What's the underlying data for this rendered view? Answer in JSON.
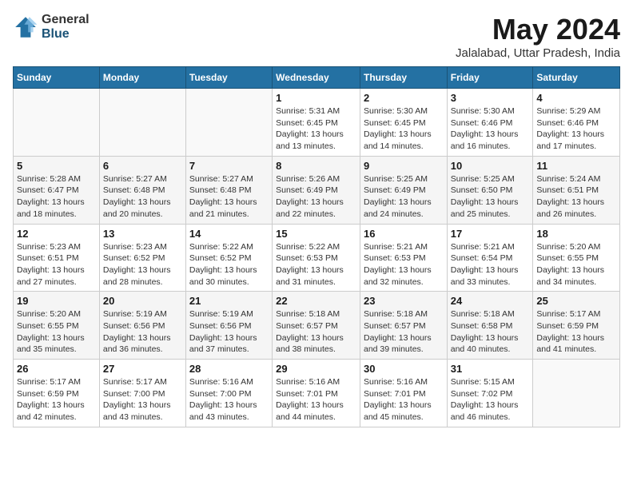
{
  "logo": {
    "general": "General",
    "blue": "Blue"
  },
  "title": "May 2024",
  "location": "Jalalabad, Uttar Pradesh, India",
  "days_of_week": [
    "Sunday",
    "Monday",
    "Tuesday",
    "Wednesday",
    "Thursday",
    "Friday",
    "Saturday"
  ],
  "weeks": [
    [
      {
        "day": "",
        "info": ""
      },
      {
        "day": "",
        "info": ""
      },
      {
        "day": "",
        "info": ""
      },
      {
        "day": "1",
        "info": "Sunrise: 5:31 AM\nSunset: 6:45 PM\nDaylight: 13 hours\nand 13 minutes."
      },
      {
        "day": "2",
        "info": "Sunrise: 5:30 AM\nSunset: 6:45 PM\nDaylight: 13 hours\nand 14 minutes."
      },
      {
        "day": "3",
        "info": "Sunrise: 5:30 AM\nSunset: 6:46 PM\nDaylight: 13 hours\nand 16 minutes."
      },
      {
        "day": "4",
        "info": "Sunrise: 5:29 AM\nSunset: 6:46 PM\nDaylight: 13 hours\nand 17 minutes."
      }
    ],
    [
      {
        "day": "5",
        "info": "Sunrise: 5:28 AM\nSunset: 6:47 PM\nDaylight: 13 hours\nand 18 minutes."
      },
      {
        "day": "6",
        "info": "Sunrise: 5:27 AM\nSunset: 6:48 PM\nDaylight: 13 hours\nand 20 minutes."
      },
      {
        "day": "7",
        "info": "Sunrise: 5:27 AM\nSunset: 6:48 PM\nDaylight: 13 hours\nand 21 minutes."
      },
      {
        "day": "8",
        "info": "Sunrise: 5:26 AM\nSunset: 6:49 PM\nDaylight: 13 hours\nand 22 minutes."
      },
      {
        "day": "9",
        "info": "Sunrise: 5:25 AM\nSunset: 6:49 PM\nDaylight: 13 hours\nand 24 minutes."
      },
      {
        "day": "10",
        "info": "Sunrise: 5:25 AM\nSunset: 6:50 PM\nDaylight: 13 hours\nand 25 minutes."
      },
      {
        "day": "11",
        "info": "Sunrise: 5:24 AM\nSunset: 6:51 PM\nDaylight: 13 hours\nand 26 minutes."
      }
    ],
    [
      {
        "day": "12",
        "info": "Sunrise: 5:23 AM\nSunset: 6:51 PM\nDaylight: 13 hours\nand 27 minutes."
      },
      {
        "day": "13",
        "info": "Sunrise: 5:23 AM\nSunset: 6:52 PM\nDaylight: 13 hours\nand 28 minutes."
      },
      {
        "day": "14",
        "info": "Sunrise: 5:22 AM\nSunset: 6:52 PM\nDaylight: 13 hours\nand 30 minutes."
      },
      {
        "day": "15",
        "info": "Sunrise: 5:22 AM\nSunset: 6:53 PM\nDaylight: 13 hours\nand 31 minutes."
      },
      {
        "day": "16",
        "info": "Sunrise: 5:21 AM\nSunset: 6:53 PM\nDaylight: 13 hours\nand 32 minutes."
      },
      {
        "day": "17",
        "info": "Sunrise: 5:21 AM\nSunset: 6:54 PM\nDaylight: 13 hours\nand 33 minutes."
      },
      {
        "day": "18",
        "info": "Sunrise: 5:20 AM\nSunset: 6:55 PM\nDaylight: 13 hours\nand 34 minutes."
      }
    ],
    [
      {
        "day": "19",
        "info": "Sunrise: 5:20 AM\nSunset: 6:55 PM\nDaylight: 13 hours\nand 35 minutes."
      },
      {
        "day": "20",
        "info": "Sunrise: 5:19 AM\nSunset: 6:56 PM\nDaylight: 13 hours\nand 36 minutes."
      },
      {
        "day": "21",
        "info": "Sunrise: 5:19 AM\nSunset: 6:56 PM\nDaylight: 13 hours\nand 37 minutes."
      },
      {
        "day": "22",
        "info": "Sunrise: 5:18 AM\nSunset: 6:57 PM\nDaylight: 13 hours\nand 38 minutes."
      },
      {
        "day": "23",
        "info": "Sunrise: 5:18 AM\nSunset: 6:57 PM\nDaylight: 13 hours\nand 39 minutes."
      },
      {
        "day": "24",
        "info": "Sunrise: 5:18 AM\nSunset: 6:58 PM\nDaylight: 13 hours\nand 40 minutes."
      },
      {
        "day": "25",
        "info": "Sunrise: 5:17 AM\nSunset: 6:59 PM\nDaylight: 13 hours\nand 41 minutes."
      }
    ],
    [
      {
        "day": "26",
        "info": "Sunrise: 5:17 AM\nSunset: 6:59 PM\nDaylight: 13 hours\nand 42 minutes."
      },
      {
        "day": "27",
        "info": "Sunrise: 5:17 AM\nSunset: 7:00 PM\nDaylight: 13 hours\nand 43 minutes."
      },
      {
        "day": "28",
        "info": "Sunrise: 5:16 AM\nSunset: 7:00 PM\nDaylight: 13 hours\nand 43 minutes."
      },
      {
        "day": "29",
        "info": "Sunrise: 5:16 AM\nSunset: 7:01 PM\nDaylight: 13 hours\nand 44 minutes."
      },
      {
        "day": "30",
        "info": "Sunrise: 5:16 AM\nSunset: 7:01 PM\nDaylight: 13 hours\nand 45 minutes."
      },
      {
        "day": "31",
        "info": "Sunrise: 5:15 AM\nSunset: 7:02 PM\nDaylight: 13 hours\nand 46 minutes."
      },
      {
        "day": "",
        "info": ""
      }
    ]
  ]
}
